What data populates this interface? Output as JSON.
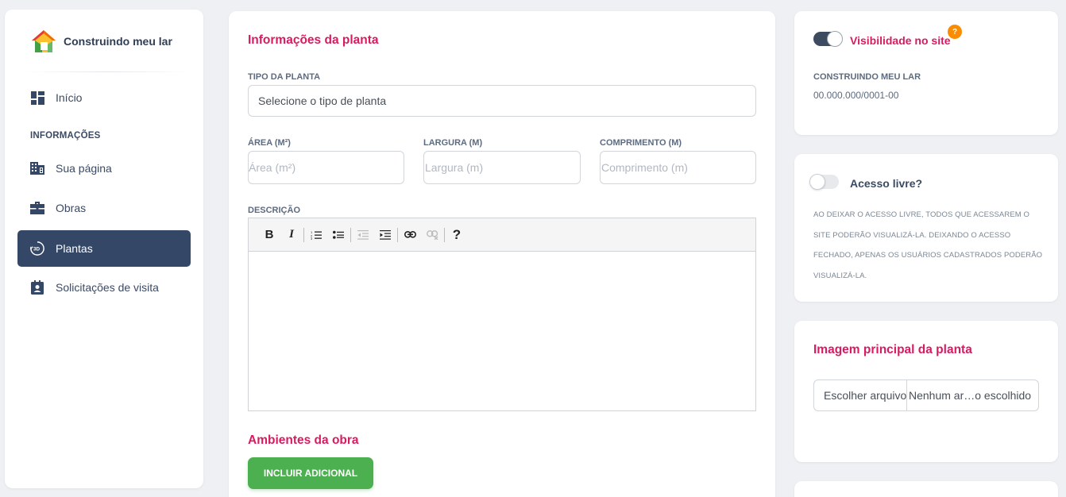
{
  "sidebar": {
    "brand": "Construindo meu lar",
    "items": [
      {
        "label": "Início",
        "icon": "dashboard-icon"
      },
      {
        "label": "Sua página",
        "icon": "building-icon"
      },
      {
        "label": "Obras",
        "icon": "briefcase-icon"
      },
      {
        "label": "Plantas",
        "icon": "3d-rotate-icon",
        "active": true
      },
      {
        "label": "Solicitações de visita",
        "icon": "contact-badge-icon"
      }
    ],
    "section_label": "INFORMAÇÕES"
  },
  "main": {
    "title": "Informações da planta",
    "tipo_label": "TIPO DA PLANTA",
    "tipo_value": "Selecione o tipo de planta",
    "area_label": "ÁREA (M²)",
    "area_placeholder": "Área (m²)",
    "largura_label": "LARGURA (M)",
    "largura_placeholder": "Largura (m)",
    "comprimento_label": "COMPRIMENTO (M)",
    "comprimento_placeholder": "Comprimento (m)",
    "descricao_label": "DESCRIÇÃO",
    "toolbar": {
      "bold": "B",
      "italic": "I",
      "help": "?"
    },
    "ambientes_title": "Ambientes da obra",
    "incluir_button": "INCLUIR ADICIONAL"
  },
  "visibility_card": {
    "label": "Visibilidade no site",
    "help": "?",
    "company_label": "CONSTRUINDO MEU LAR",
    "cnpj": "00.000.000/0001-00",
    "toggle_on": true
  },
  "access_card": {
    "label": "Acesso livre?",
    "note": "AO DEIXAR O ACESSO LIVRE, TODOS QUE ACESSAREM O SITE PODERÃO VISUALIZÁ-LA. DEIXANDO O ACESSO FECHADO, APENAS OS USUÁRIOS CADASTRADOS PODERÃO VISUALIZÁ-LA.",
    "toggle_on": false
  },
  "image_card": {
    "title": "Imagem principal da planta",
    "file_button": "Escolher arquivo",
    "file_name": "Nenhum ar…o escolhido"
  },
  "colors": {
    "accent_pink": "#d81b60",
    "sidebar_active": "#344767",
    "button_green": "#4caf50",
    "help_orange": "#fb8c00"
  }
}
